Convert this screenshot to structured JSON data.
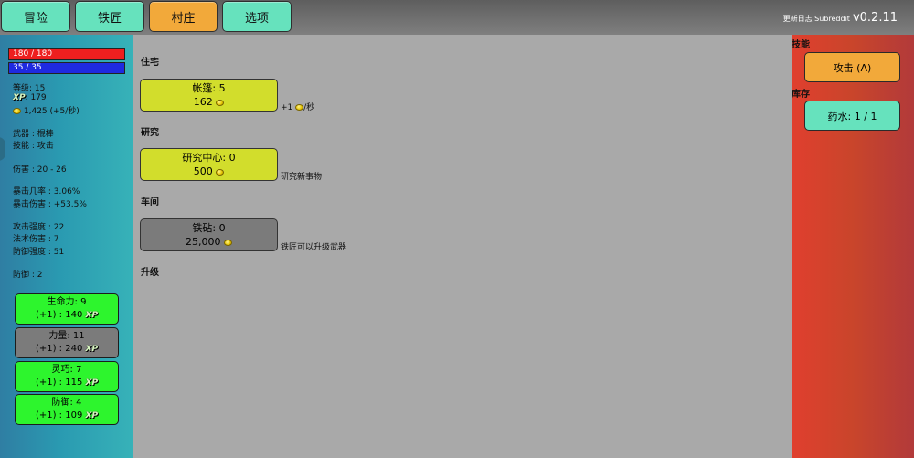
{
  "tabs": [
    {
      "label": "冒险",
      "active": false
    },
    {
      "label": "铁匠",
      "active": false
    },
    {
      "label": "村庄",
      "active": true
    },
    {
      "label": "选项",
      "active": false
    }
  ],
  "version": {
    "small": "更新日志 Subreddit",
    "number": "v0.2.11"
  },
  "player": {
    "hp": "180 / 180",
    "mp": "35 / 35",
    "level": "等级: 15",
    "xp_label": "XP",
    "xp": ": 179",
    "gold": "1,425 (+5/秒)",
    "weapon": "武器 : 棍棒",
    "skill": "技能 : 攻击",
    "damage": "伤害 : 20 - 26",
    "crit_rate": "暴击几率 : 3.06%",
    "crit_dmg": "暴击伤害 : +53.5%",
    "attack_power": "攻击强度 : 22",
    "spell_power": "法术伤害 : 7",
    "defense_power": "防御强度 : 51",
    "defense": "防御 : 2"
  },
  "attributes": [
    {
      "name": "生命力: 9",
      "cost": "(+1) : 140",
      "xp": "XP",
      "enabled": true
    },
    {
      "name": "力量: 11",
      "cost": "(+1) : 240",
      "xp": "XP",
      "enabled": false
    },
    {
      "name": "灵巧: 7",
      "cost": "(+1) : 115",
      "xp": "XP",
      "enabled": true
    },
    {
      "name": "防御: 4",
      "cost": "(+1) : 109",
      "xp": "XP",
      "enabled": true
    }
  ],
  "village": {
    "housing": {
      "title": "住宅",
      "name": "帐篷: 5",
      "cost": "162",
      "desc_pre": "+1",
      "desc_post": "/秒"
    },
    "research": {
      "title": "研究",
      "name": "研究中心: 0",
      "cost": "500",
      "desc": "研究新事物"
    },
    "workshop": {
      "title": "车间",
      "name": "铁砧: 0",
      "cost": "25,000",
      "desc": "铁匠可以升级武器"
    },
    "upgrades_title": "升级"
  },
  "right_panel": {
    "skills_title": "技能",
    "attack_btn": "攻击 (A)",
    "inventory_title": "库存",
    "potion_btn": "药水: 1 / 1"
  },
  "colors": {
    "tab_teal": "#66e2bd",
    "tab_active": "#f2a93a",
    "hp": "#ee1f1f",
    "mp": "#1f2ae0",
    "attr_green": "#2df52d",
    "building_yellow": "#d2dd2c"
  }
}
